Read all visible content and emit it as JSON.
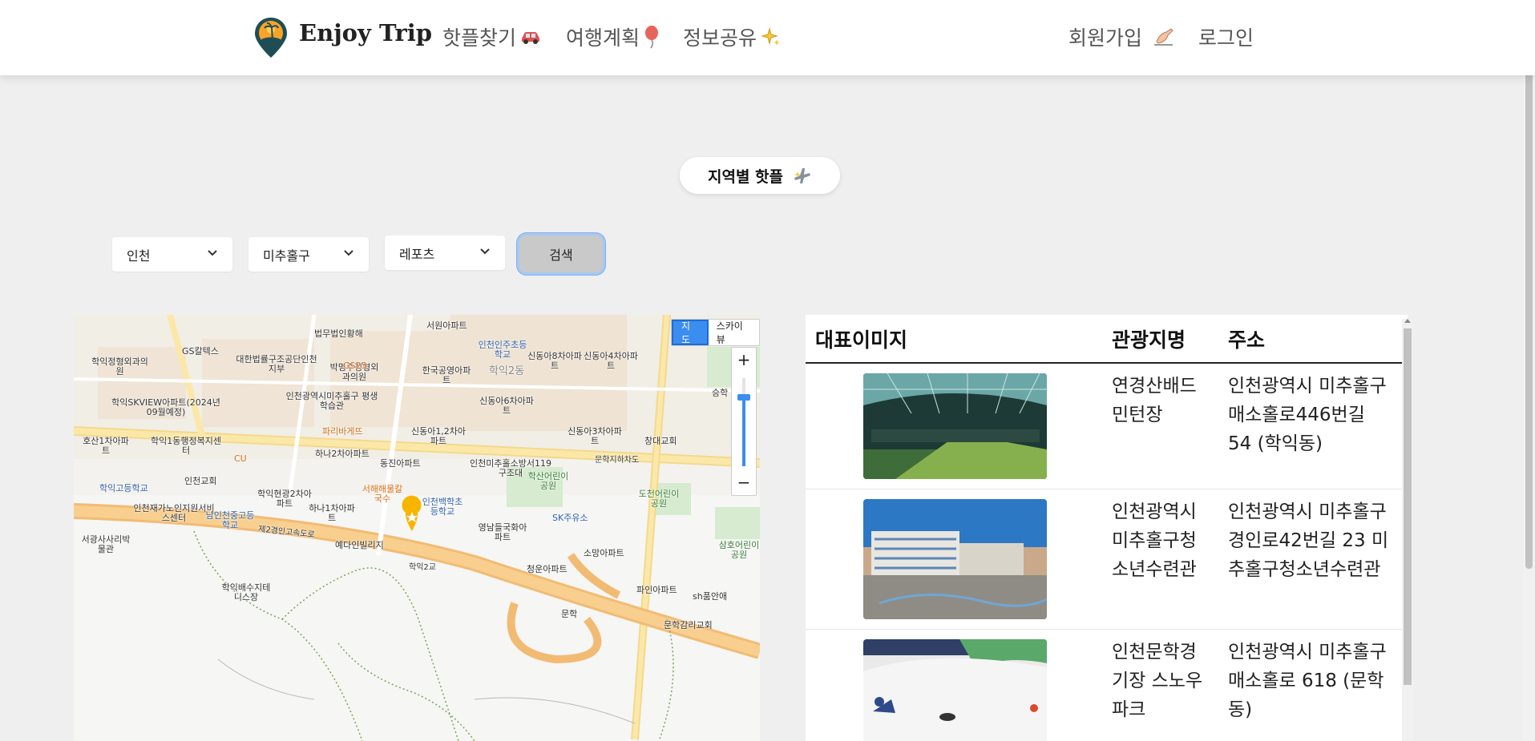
{
  "header": {
    "brand": "Enjoy Trip",
    "nav": [
      {
        "label": "핫플찾기",
        "icon": "car-icon"
      },
      {
        "label": "여행계획",
        "icon": "balloon-icon"
      },
      {
        "label": "정보공유",
        "icon": "sparkles-icon"
      }
    ],
    "signup": {
      "label": "회원가입",
      "icon": "writing-hand-icon"
    },
    "login": "로그인"
  },
  "section": {
    "title": "지역별 핫플",
    "icon": "airplane-icon"
  },
  "filters": {
    "city": "인천",
    "district": "미추홀구",
    "category": "레포츠",
    "search_label": "검색"
  },
  "map": {
    "map_type_selected": "지도",
    "map_type_other": "스카이뷰",
    "zoom_in": "+",
    "zoom_out": "−",
    "labels": [
      "서원아파트",
      "법무법인황해",
      "인천인주초등학교",
      "신동아8차아파트",
      "신동아4차아파트",
      "GS칼텍스",
      "대한법률구조공단인천지부",
      "박명주정형외과의원",
      "한국공영아파트",
      "학익2동",
      "학익정형외과의원",
      "인천광역시미추홀구 평생학습관",
      "학익SKVIEW아파트(2024년09월예정)",
      "신동아6차아파트",
      "파리바게뜨",
      "신동아1,2차아파트",
      "신동아3차아파트",
      "창대교회",
      "호산1차아파트",
      "학익1동행정복지센터",
      "하나2차아파트",
      "동진아파트",
      "인천미추홀소방서119구조대",
      "학산어린이공원",
      "도천어린이공원",
      "학익고등학교",
      "인천교회",
      "학익현광2차아파트",
      "하나1차아파트",
      "서해해물칼국수",
      "인천백학초등학교",
      "영남들국화아파트",
      "SK주유소",
      "인천재가노인지원서비스센터",
      "남인천중고등학교",
      "제2경인고속도로",
      "예다인빌리지",
      "소망아파트",
      "삼호어린이공원",
      "서광사사리박물관",
      "학익2교",
      "청운아파트",
      "파인아파트",
      "학익배수지테니스장",
      "sh품안애",
      "문학",
      "문학감리교회",
      "문학지하차도",
      "승학",
      "GS25",
      "CU"
    ]
  },
  "table": {
    "headers": [
      "대표이미지",
      "관광지명",
      "주소"
    ],
    "rows": [
      {
        "name": "연경산배드민턴장",
        "address": "인천광역시 미추홀구 매소홀로446번길 54 (학익동)"
      },
      {
        "name": "인천광역시미추홀구청소년수련관",
        "address": "인천광역시 미추홀구 경인로42번길 23 미추홀구청소년수련관"
      },
      {
        "name": "인천문학경기장 스노우파크",
        "address": "인천광역시 미추홀구 매소홀로 618 (문학동)"
      }
    ]
  }
}
